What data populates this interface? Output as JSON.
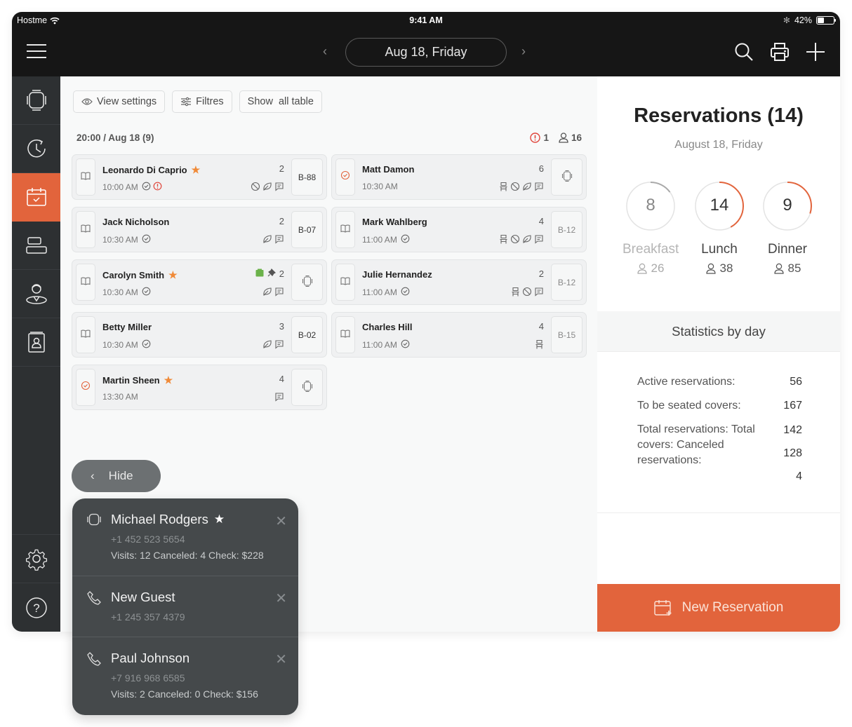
{
  "status_bar": {
    "carrier": "Hostme",
    "time": "9:41 AM",
    "battery": "42%",
    "battery_level": 0.42
  },
  "topbar": {
    "date": "Aug 18, Friday",
    "prev": "‹",
    "next": "›"
  },
  "sidebar": {
    "items": [
      {
        "name": "tables",
        "active": false
      },
      {
        "name": "history",
        "active": false
      },
      {
        "name": "reservations",
        "active": true
      },
      {
        "name": "layout",
        "active": false
      },
      {
        "name": "staff",
        "active": false
      },
      {
        "name": "guestbook",
        "active": false
      }
    ],
    "bottom": [
      {
        "name": "settings"
      },
      {
        "name": "help",
        "label": "?"
      }
    ]
  },
  "toolbar": {
    "view_settings": "View settings",
    "filters": "Filtres",
    "show_all": "Show  all table"
  },
  "group": {
    "title": "20:00 / Aug 18 (9)",
    "alerts": "1",
    "guests": "16"
  },
  "reservations": [
    {
      "name": "Leonardo Di Caprio",
      "vip": true,
      "time": "10:00 AM",
      "confirmed": true,
      "alert": true,
      "covers": "2",
      "tags": [
        "no",
        "leaf",
        "note"
      ],
      "table": "B-88",
      "seated": false
    },
    {
      "name": "Matt Damon",
      "vip": false,
      "time": "10:30 AM",
      "confirmed": false,
      "alert": false,
      "covers": "6",
      "tags": [
        "chair",
        "no",
        "leaf",
        "note"
      ],
      "table": "",
      "seated": true
    },
    {
      "name": "Jack Nicholson",
      "vip": false,
      "time": "10:30 AM",
      "confirmed": true,
      "alert": false,
      "covers": "2",
      "tags": [
        "leaf",
        "note"
      ],
      "table": "B-07",
      "seated": false
    },
    {
      "name": "Mark Wahlberg",
      "vip": false,
      "time": "11:00 AM",
      "confirmed": true,
      "alert": false,
      "covers": "4",
      "tags": [
        "chair",
        "no",
        "leaf",
        "note"
      ],
      "table": "B-12",
      "seated": false,
      "muted": true
    },
    {
      "name": "Carolyn Smith",
      "vip": true,
      "time": "10:30 AM",
      "confirmed": true,
      "alert": false,
      "covers": "2",
      "tags": [
        "leaf",
        "note"
      ],
      "extra": [
        "gift",
        "pin"
      ],
      "table": "",
      "seated": false
    },
    {
      "name": "Julie Hernandez",
      "vip": false,
      "time": "11:00 AM",
      "confirmed": true,
      "alert": false,
      "covers": "2",
      "tags": [
        "chair",
        "no",
        "note"
      ],
      "table": "B-12",
      "seated": false,
      "muted": true
    },
    {
      "name": "Betty Miller",
      "vip": false,
      "time": "10:30 AM",
      "confirmed": true,
      "alert": false,
      "covers": "3",
      "tags": [
        "leaf",
        "note"
      ],
      "table": "B-02",
      "seated": false
    },
    {
      "name": "Charles Hill",
      "vip": false,
      "time": "11:00 AM",
      "confirmed": true,
      "alert": false,
      "covers": "4",
      "tags": [
        "chair"
      ],
      "table": "B-15",
      "seated": false,
      "muted": true
    },
    {
      "name": "Martin Sheen",
      "vip": true,
      "time": "13:30 AM",
      "confirmed": false,
      "alert": false,
      "covers": "4",
      "tags": [
        "note"
      ],
      "table": "",
      "seated": true
    }
  ],
  "hide_label": "Hide",
  "calls": [
    {
      "name": "Michael Rodgers",
      "vip": true,
      "icon": "table",
      "phone": "+1 452 523 5654",
      "visits": "Visits: 12  Canceled: 4  Check: $228"
    },
    {
      "name": "New Guest",
      "vip": false,
      "icon": "phone",
      "phone": "+1 245 357 4379",
      "visits": ""
    },
    {
      "name": "Paul Johnson",
      "vip": false,
      "icon": "phone",
      "phone": "+7 916 968 6585",
      "visits": "Visits: 2  Canceled: 0  Check: $156"
    }
  ],
  "summary": {
    "title": "Reservations (14)",
    "subtitle": "August 18, Friday",
    "meals": [
      {
        "label": "Breakfast",
        "count": "8",
        "covers": "26",
        "progress": 0.15,
        "color": "#a9a9a9",
        "dim": true
      },
      {
        "label": "Lunch",
        "count": "14",
        "covers": "38",
        "progress": 0.42,
        "color": "#e2643c",
        "dim": false
      },
      {
        "label": "Dinner",
        "count": "9",
        "covers": "85",
        "progress": 0.3,
        "color": "#e2643c",
        "dim": false
      }
    ],
    "stats_title": "Statistics by day",
    "stats": [
      {
        "label": "Active reservations:",
        "value": "56"
      },
      {
        "label": "To be seated covers:",
        "value": "167"
      },
      {
        "label": "Total reservations: Total covers: Canceled reservations:",
        "values": [
          "142",
          "128",
          "4"
        ]
      }
    ],
    "new_reservation": "New Reservation"
  },
  "colors": {
    "accent": "#e2643c",
    "sidebar": "#2d3032",
    "topbar": "#161616",
    "star": "#f08a38",
    "alert": "#e0463c",
    "gift": "#6bb24a"
  }
}
